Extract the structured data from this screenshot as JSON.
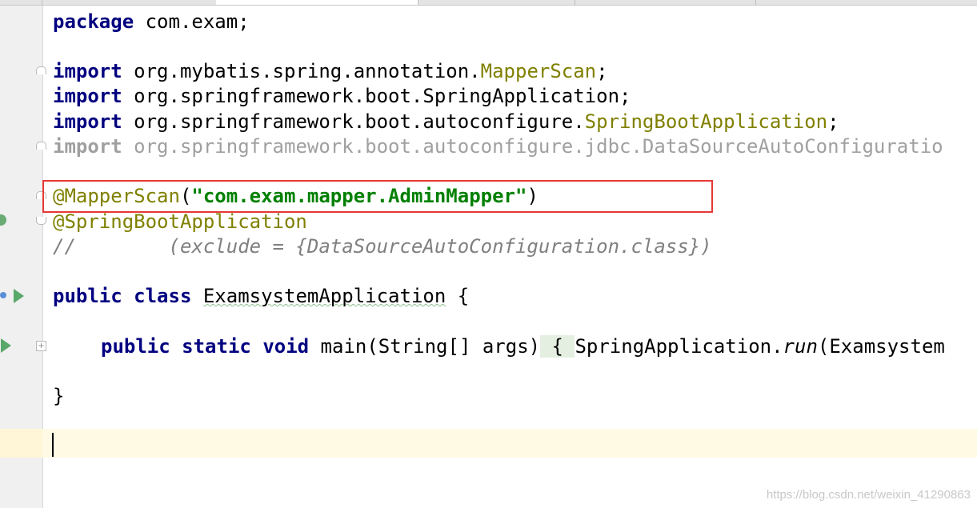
{
  "code": {
    "package_kw": "package",
    "package_name": " com.exam;",
    "import_kw": "import",
    "imports": [
      {
        "pre": " org.mybatis.spring.annotation.",
        "cls": "MapperScan",
        "post": ";"
      },
      {
        "pre": " org.springframework.boot.",
        "cls": "SpringApplication",
        "post": ";"
      },
      {
        "pre": " org.springframework.boot.autoconfigure.",
        "cls": "SpringBootApplication",
        "post": ";"
      },
      {
        "pre": " org.springframework.boot.autoconfigure.jdbc.DataSourceAutoConfiguratio",
        "cls": "",
        "post": ""
      }
    ],
    "mapperscan_annotation": "@MapperScan",
    "mapperscan_open": "(",
    "mapperscan_value": "\"com.exam.mapper.AdminMapper\"",
    "mapperscan_close": ")",
    "springboot_annotation": "@SpringBootApplication",
    "comment_line": "//        (exclude = {DataSourceAutoConfiguration.class})",
    "class_kw1": "public",
    "class_kw2": "class",
    "class_name": "ExamsystemApplication",
    "class_open": " {",
    "main_kw1": "public",
    "main_kw2": "static",
    "main_kw3": "void",
    "main_sig": " main(String[] args)",
    "main_brace": " { ",
    "main_body_1": "SpringApplication.",
    "main_body_run": "run",
    "main_body_2": "(Examsystem",
    "class_close": "}"
  },
  "watermark": "https://blog.csdn.net/weixin_41290863",
  "colors": {
    "keyword": "#000080",
    "annotation": "#808000",
    "string": "#008000",
    "comment": "#808080",
    "highlight_box": "#e53935"
  }
}
